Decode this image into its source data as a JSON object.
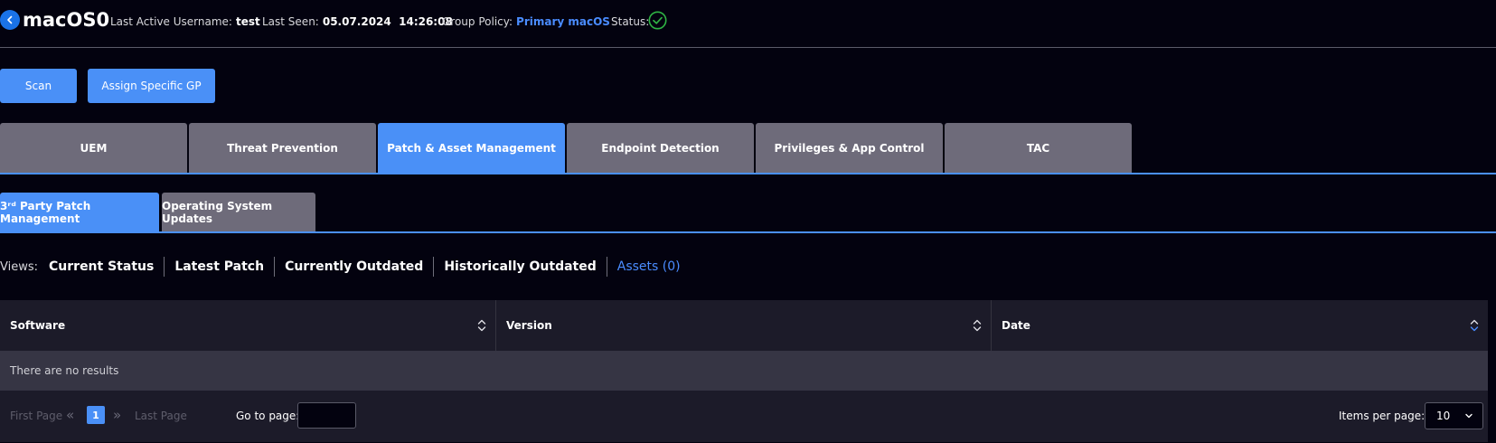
{
  "header": {
    "device_name": "macOS0",
    "last_active_label": "Last Active Username:",
    "last_active_value": "test",
    "last_seen_label": "Last Seen:",
    "last_seen_value": "05.07.2024  14:26:08",
    "group_policy_label": "Group Policy:",
    "group_policy_value": "Primary macOS",
    "status_label": "Status:",
    "status_icon": "check-circle-icon",
    "status_color": "#2fb344"
  },
  "actions": {
    "scan_label": "Scan",
    "assign_label": "Assign Specific GP"
  },
  "tabs": [
    {
      "label": "UEM",
      "active": false
    },
    {
      "label": "Threat Prevention",
      "active": false
    },
    {
      "label": "Patch & Asset Management",
      "active": true
    },
    {
      "label": "Endpoint Detection",
      "active": false
    },
    {
      "label": "Privileges & App Control",
      "active": false
    },
    {
      "label": "TAC",
      "active": false
    }
  ],
  "subtabs": [
    {
      "label": "3ʳᵈ Party Patch Management",
      "active": true
    },
    {
      "label": "Operating System Updates",
      "active": false
    }
  ],
  "views": {
    "label": "Views:",
    "items": [
      {
        "label": "Current Status",
        "active": false
      },
      {
        "label": "Latest Patch",
        "active": false
      },
      {
        "label": "Currently Outdated",
        "active": false
      },
      {
        "label": "Historically Outdated",
        "active": false
      },
      {
        "label": "Assets (0)",
        "active": true
      }
    ]
  },
  "table": {
    "columns": [
      "Software",
      "Version",
      "Date"
    ],
    "empty_message": "There are no results"
  },
  "pagination": {
    "first_page": "First Page",
    "last_page": "Last Page",
    "prev_icon": "«",
    "next_icon": "»",
    "current_page": "1",
    "goto_label": "Go to page:",
    "goto_value": "",
    "items_per_page_label": "Items per page:",
    "items_per_page_value": "10"
  },
  "colors": {
    "background": "#03020f",
    "accent": "#4a90f7",
    "tab_inactive": "#6e6b7a",
    "link": "#4a8cff"
  }
}
